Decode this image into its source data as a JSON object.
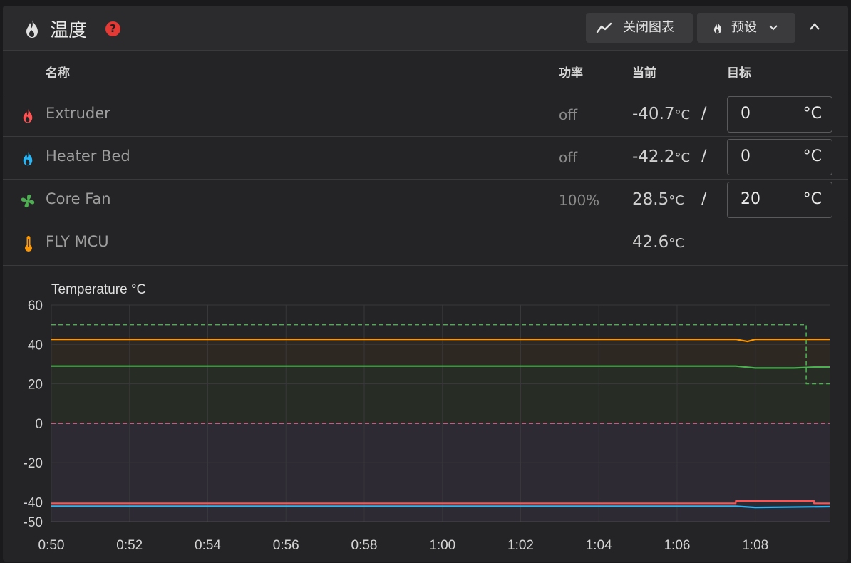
{
  "header": {
    "title": "温度",
    "help": "?",
    "chart_button": "关闭图表",
    "preset_button": "预设"
  },
  "columns": {
    "name": "名称",
    "power": "功率",
    "current": "当前",
    "target": "目标"
  },
  "rows": [
    {
      "name": "Extruder",
      "power": "off",
      "current": "-40.7",
      "unit": "°C",
      "target": "0",
      "target_unit": "°C",
      "icon": "flame-icon",
      "color": "#ff5252"
    },
    {
      "name": "Heater Bed",
      "power": "off",
      "current": "-42.2",
      "unit": "°C",
      "target": "0",
      "target_unit": "°C",
      "icon": "flame-icon",
      "color": "#29b6f6"
    },
    {
      "name": "Core Fan",
      "power": "100%",
      "current": "28.5",
      "unit": "°C",
      "target": "20",
      "target_unit": "°C",
      "icon": "fan-icon",
      "color": "#4caf50"
    },
    {
      "name": "FLY MCU",
      "power": "",
      "current": "42.6",
      "unit": "°C",
      "icon": "thermometer-icon",
      "color": "#ff9800"
    }
  ],
  "chart_data": {
    "type": "line",
    "title": "Temperature °C",
    "xlabel": "",
    "ylabel": "",
    "ylim": [
      -50,
      60
    ],
    "yticks": [
      "60",
      "40",
      "20",
      "0",
      "-20",
      "-40",
      "-50"
    ],
    "xlim_minutes": [
      50,
      69.9
    ],
    "xticks": [
      "0:50",
      "0:52",
      "0:54",
      "0:56",
      "0:58",
      "1:00",
      "1:02",
      "1:04",
      "1:06",
      "1:08"
    ],
    "grid": true,
    "legend": "none",
    "series": [
      {
        "color": "#ff9800",
        "style": "solid",
        "x": [
          "0:50",
          "1:07.5",
          "1:07.8",
          "1:08",
          "1:09.9"
        ],
        "y": [
          42.6,
          42.6,
          41.5,
          42.6,
          42.6
        ]
      },
      {
        "color": "#4caf50",
        "style": "solid",
        "x": [
          "0:50",
          "1:07.5",
          "1:08",
          "1:09",
          "1:09.5",
          "1:09.9"
        ],
        "y": [
          29,
          29,
          28,
          28,
          28.5,
          28.5
        ]
      },
      {
        "color": "#4caf50",
        "style": "dashed",
        "x": [
          "0:50",
          "1:09.3",
          "1:09.3",
          "1:09.9"
        ],
        "y": [
          50,
          50,
          20,
          20
        ]
      },
      {
        "color": "#ff5252",
        "style": "solid",
        "x": [
          "0:50",
          "1:07.5",
          "1:07.5",
          "1:09.5",
          "1:09.5",
          "1:09.9"
        ],
        "y": [
          -40.7,
          -40.7,
          -39.5,
          -39.5,
          -40.7,
          -40.7
        ]
      },
      {
        "color": "#29b6f6",
        "style": "solid",
        "x": [
          "0:50",
          "1:07.5",
          "1:08",
          "1:09.9"
        ],
        "y": [
          -42.2,
          -42.2,
          -42.8,
          -42.4
        ]
      },
      {
        "color": "#f48fb1",
        "style": "dashed",
        "x": [
          "0:50",
          "1:09.9"
        ],
        "y": [
          0,
          0
        ]
      }
    ]
  }
}
